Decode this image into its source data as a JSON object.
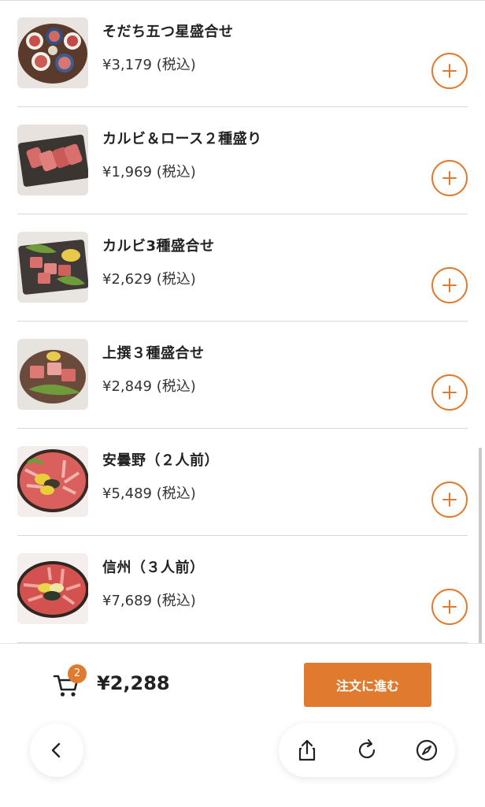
{
  "menu": {
    "items": [
      {
        "name": "そだち五つ星盛合せ",
        "price": "¥3,179 (税込)",
        "image": "assorted-meat-five-dishes"
      },
      {
        "name": "カルビ＆ロース２種盛り",
        "price": "¥1,969 (税込)",
        "image": "kalbi-loin-platter"
      },
      {
        "name": "カルビ3種盛合せ",
        "price": "¥2,629 (税込)",
        "image": "kalbi-three-platter"
      },
      {
        "name": "上撰３種盛合せ",
        "price": "¥2,849 (税込)",
        "image": "premium-three-platter"
      },
      {
        "name": "安曇野（２人前）",
        "price": "¥5,489 (税込)",
        "image": "azumino-round-platter"
      },
      {
        "name": "信州（３人前）",
        "price": "¥7,689 (税込)",
        "image": "shinshu-round-platter"
      }
    ]
  },
  "cart": {
    "count": "2",
    "total": "¥2,288",
    "order_label": "注文に進む"
  },
  "browser": {
    "icons": [
      "chevron-left-icon",
      "share-icon",
      "reload-icon",
      "compass-icon"
    ]
  },
  "colors": {
    "accent": "#e07a2e",
    "divider": "#d8d8d8",
    "text": "#222222"
  }
}
